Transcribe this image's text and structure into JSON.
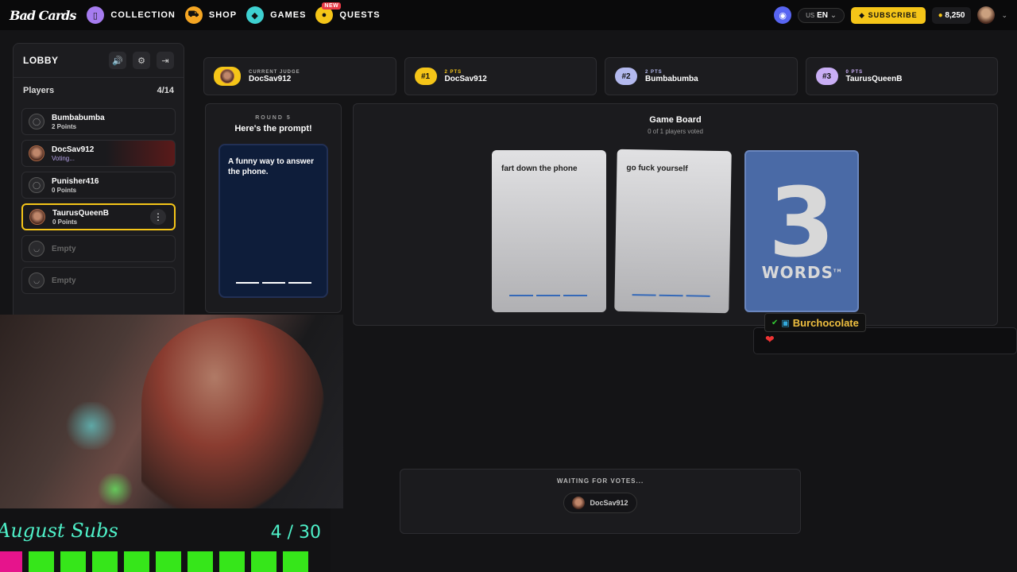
{
  "topbar": {
    "logo": "Bad Cards",
    "nav": [
      {
        "label": "COLLECTION",
        "icon": "cards-icon",
        "color": "#a67cf0",
        "glyph": "▯"
      },
      {
        "label": "SHOP",
        "icon": "cart-icon",
        "color": "#f5a623",
        "glyph": "🛒"
      },
      {
        "label": "GAMES",
        "icon": "gamepad-icon",
        "color": "#3ed1d1",
        "glyph": "◆"
      },
      {
        "label": "QUESTS",
        "icon": "quest-icon",
        "color": "#f5c518",
        "glyph": "●",
        "badge": "NEW"
      }
    ],
    "lang_region": "US",
    "lang": "EN",
    "subscribe": "SUBSCRIBE",
    "coins": "8,250"
  },
  "lobby": {
    "title": "LOBBY",
    "players_label": "Players",
    "players_count": "4/14",
    "players": [
      {
        "name": "Bumbabumba",
        "status": "2 Points"
      },
      {
        "name": "DocSav912",
        "status": "Voting..."
      },
      {
        "name": "Punisher416",
        "status": "0 Points"
      },
      {
        "name": "TaurusQueenB",
        "status": "0 Points"
      }
    ],
    "empty_label": "Empty"
  },
  "scores": {
    "judge_label": "CURRENT JUDGE",
    "judge_name": "DocSav912",
    "ranks": [
      {
        "rank": "#1",
        "pts": "2 PTS",
        "name": "DocSav912",
        "color": "#f5c518"
      },
      {
        "rank": "#2",
        "pts": "2 PTS",
        "name": "Bumbabumba",
        "color": "#b3b9ee"
      },
      {
        "rank": "#3",
        "pts": "0 PTS",
        "name": "TaurusQueenB",
        "color": "#c9aef5"
      }
    ]
  },
  "prompt": {
    "round": "ROUND 5",
    "title": "Here's the prompt!",
    "text": "A funny way to answer the phone."
  },
  "board": {
    "title": "Game Board",
    "subtitle": "0 of 1 players voted",
    "cards": [
      "fart down the phone",
      "go fuck yourself"
    ],
    "special_card_number": "3",
    "special_card_word": "WORDS",
    "special_card_mark": "TM"
  },
  "chat": {
    "username": "Burchocolate",
    "message": "❤"
  },
  "waiting": {
    "title": "WAITING FOR VOTES...",
    "player": "DocSav912"
  },
  "subs": {
    "title": "August Subs",
    "count": "4 / 30",
    "filled": 10
  }
}
